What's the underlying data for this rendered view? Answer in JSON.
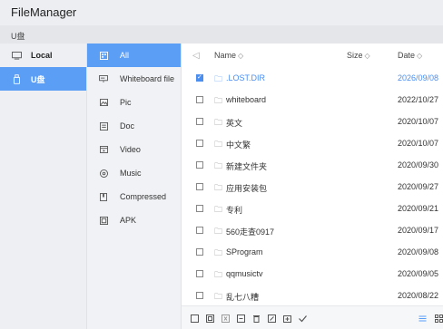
{
  "app": {
    "title": "FileManager"
  },
  "path": "U盘",
  "devices": [
    {
      "label": "Local",
      "icon": "monitor-icon",
      "active": false
    },
    {
      "label": "U盘",
      "icon": "usb-drive-icon",
      "active": true
    }
  ],
  "categories": [
    {
      "label": "All",
      "icon": "all-files-icon",
      "active": true
    },
    {
      "label": "Whiteboard file",
      "icon": "whiteboard-icon",
      "active": false
    },
    {
      "label": "Pic",
      "icon": "picture-icon",
      "active": false
    },
    {
      "label": "Doc",
      "icon": "document-icon",
      "active": false
    },
    {
      "label": "Video",
      "icon": "video-icon",
      "active": false
    },
    {
      "label": "Music",
      "icon": "music-icon",
      "active": false
    },
    {
      "label": "Compressed",
      "icon": "archive-icon",
      "active": false
    },
    {
      "label": "APK",
      "icon": "apk-icon",
      "active": false
    }
  ],
  "file_list": {
    "columns": {
      "name": "Name",
      "size": "Size",
      "date": "Date"
    },
    "rows": [
      {
        "name": ".LOST.DIR",
        "date": "2026/09/08",
        "selected": true
      },
      {
        "name": "whiteboard",
        "date": "2022/10/27",
        "selected": false
      },
      {
        "name": "英文",
        "date": "2020/10/07",
        "selected": false
      },
      {
        "name": "中文繁",
        "date": "2020/10/07",
        "selected": false
      },
      {
        "name": "新建文件夹",
        "date": "2020/09/30",
        "selected": false
      },
      {
        "name": "应用安装包",
        "date": "2020/09/27",
        "selected": false
      },
      {
        "name": "专利",
        "date": "2020/09/21",
        "selected": false
      },
      {
        "name": "560走查0917",
        "date": "2020/09/17",
        "selected": false
      },
      {
        "name": "SProgram",
        "date": "2020/09/08",
        "selected": false
      },
      {
        "name": "qqmusictv",
        "date": "2020/09/05",
        "selected": false
      },
      {
        "name": "乱七八糟",
        "date": "2020/08/22",
        "selected": false
      }
    ]
  },
  "toolbar": {
    "tools": [
      "select-all-checkbox-icon",
      "copy-icon",
      "cut-icon",
      "paste-icon",
      "delete-icon",
      "rename-icon",
      "new-folder-icon",
      "confirm-check-icon",
      "list-view-icon",
      "grid-view-icon"
    ]
  },
  "colors": {
    "accent": "#5a9ef6",
    "selected_text": "#4a8ef0"
  }
}
